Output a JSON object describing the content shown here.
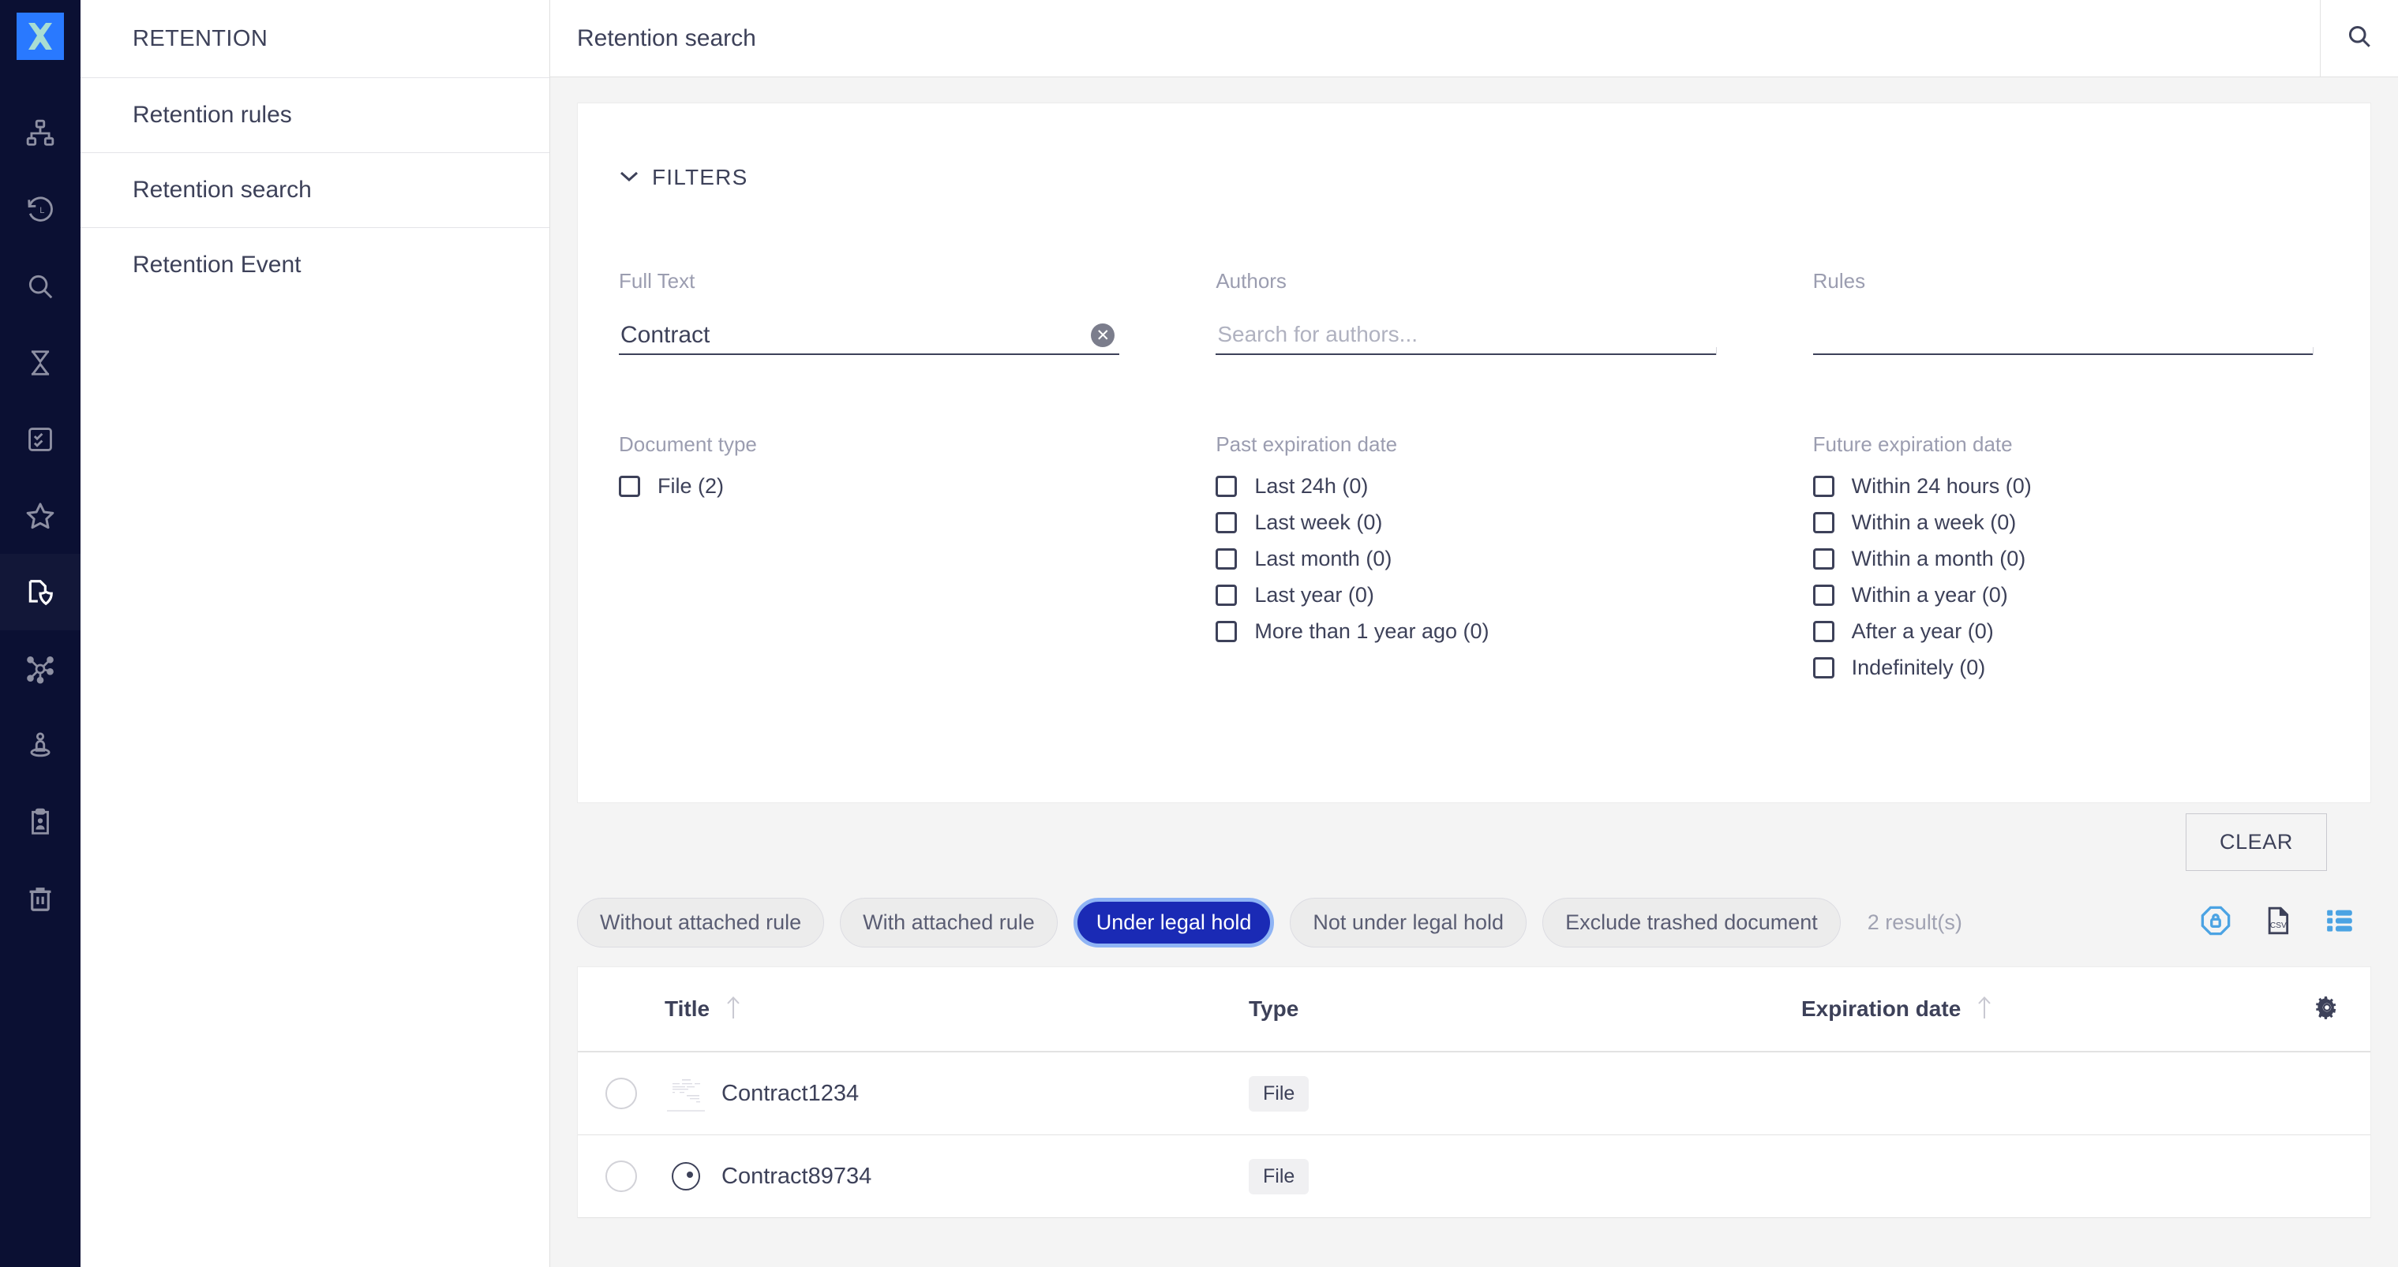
{
  "brand": {
    "logo_letter": "X",
    "logo_bg": "#2979ff",
    "logo_fg": "#a8ddd3"
  },
  "rail": {
    "items": [
      {
        "name": "hierarchy-icon",
        "label": "Organization",
        "active": false
      },
      {
        "name": "history-icon",
        "label": "History",
        "active": false
      },
      {
        "name": "search-icon",
        "label": "Search",
        "active": false
      },
      {
        "name": "hourglass-icon",
        "label": "Pending",
        "active": false
      },
      {
        "name": "checklist-icon",
        "label": "Tasks",
        "active": false
      },
      {
        "name": "star-icon",
        "label": "Favorites",
        "active": false
      },
      {
        "name": "document-shield-icon",
        "label": "Retention",
        "active": true
      },
      {
        "name": "network-icon",
        "label": "Network",
        "active": false
      },
      {
        "name": "person-location-icon",
        "label": "Person",
        "active": false
      },
      {
        "name": "clipboard-person-icon",
        "label": "Records",
        "active": false
      },
      {
        "name": "trash-icon",
        "label": "Trash",
        "active": false
      }
    ]
  },
  "sidebar": {
    "title": "RETENTION",
    "items": [
      {
        "label": "Retention rules"
      },
      {
        "label": "Retention search"
      },
      {
        "label": "Retention Event"
      }
    ]
  },
  "topbar": {
    "title": "Retention search",
    "search_icon": "search-icon"
  },
  "filters": {
    "header_label": "FILTERS",
    "expanded": true,
    "fulltext": {
      "label": "Full Text",
      "value": "Contract",
      "clear_glyph": "✕"
    },
    "authors": {
      "label": "Authors",
      "value": "",
      "placeholder": "Search for authors..."
    },
    "rules": {
      "label": "Rules",
      "value": "",
      "placeholder": ""
    },
    "document_type": {
      "label": "Document type",
      "options": [
        {
          "label": "File (2)",
          "checked": false
        }
      ]
    },
    "past_expiration": {
      "label": "Past expiration date",
      "options": [
        {
          "label": "Last 24h (0)",
          "checked": false
        },
        {
          "label": "Last week (0)",
          "checked": false
        },
        {
          "label": "Last month (0)",
          "checked": false
        },
        {
          "label": "Last year (0)",
          "checked": false
        },
        {
          "label": "More than 1 year ago (0)",
          "checked": false
        }
      ]
    },
    "future_expiration": {
      "label": "Future expiration date",
      "options": [
        {
          "label": "Within 24 hours (0)",
          "checked": false
        },
        {
          "label": "Within a week (0)",
          "checked": false
        },
        {
          "label": "Within a month (0)",
          "checked": false
        },
        {
          "label": "Within a year (0)",
          "checked": false
        },
        {
          "label": "After a year (0)",
          "checked": false
        },
        {
          "label": "Indefinitely (0)",
          "checked": false
        }
      ]
    },
    "clear_button": "CLEAR"
  },
  "chips": {
    "items": [
      {
        "label": "Without attached rule",
        "active": false
      },
      {
        "label": "With attached rule",
        "active": false
      },
      {
        "label": "Under legal hold",
        "active": true
      },
      {
        "label": "Not under legal hold",
        "active": false
      },
      {
        "label": "Exclude trashed document",
        "active": false
      }
    ],
    "active_color": "#1a2ab5",
    "active_ring_color": "#8fb4f5",
    "results_count": "2 result(s)",
    "actions": [
      {
        "name": "legal-hold-icon",
        "color": "#4ba3e3"
      },
      {
        "name": "csv-export-icon",
        "color": "#3d4159"
      },
      {
        "name": "list-view-icon",
        "color": "#4ba3e3"
      }
    ]
  },
  "table": {
    "columns": [
      {
        "key": "title",
        "label": "Title",
        "sortable": true
      },
      {
        "key": "type",
        "label": "Type",
        "sortable": false
      },
      {
        "key": "expiration",
        "label": "Expiration date",
        "sortable": true
      }
    ],
    "settings_icon": "gear-icon",
    "rows": [
      {
        "title": "Contract1234",
        "type": "File",
        "expiration": "",
        "thumb": "document-preview-icon"
      },
      {
        "title": "Contract89734",
        "type": "File",
        "expiration": "",
        "thumb": "circle-dot-icon"
      }
    ]
  }
}
